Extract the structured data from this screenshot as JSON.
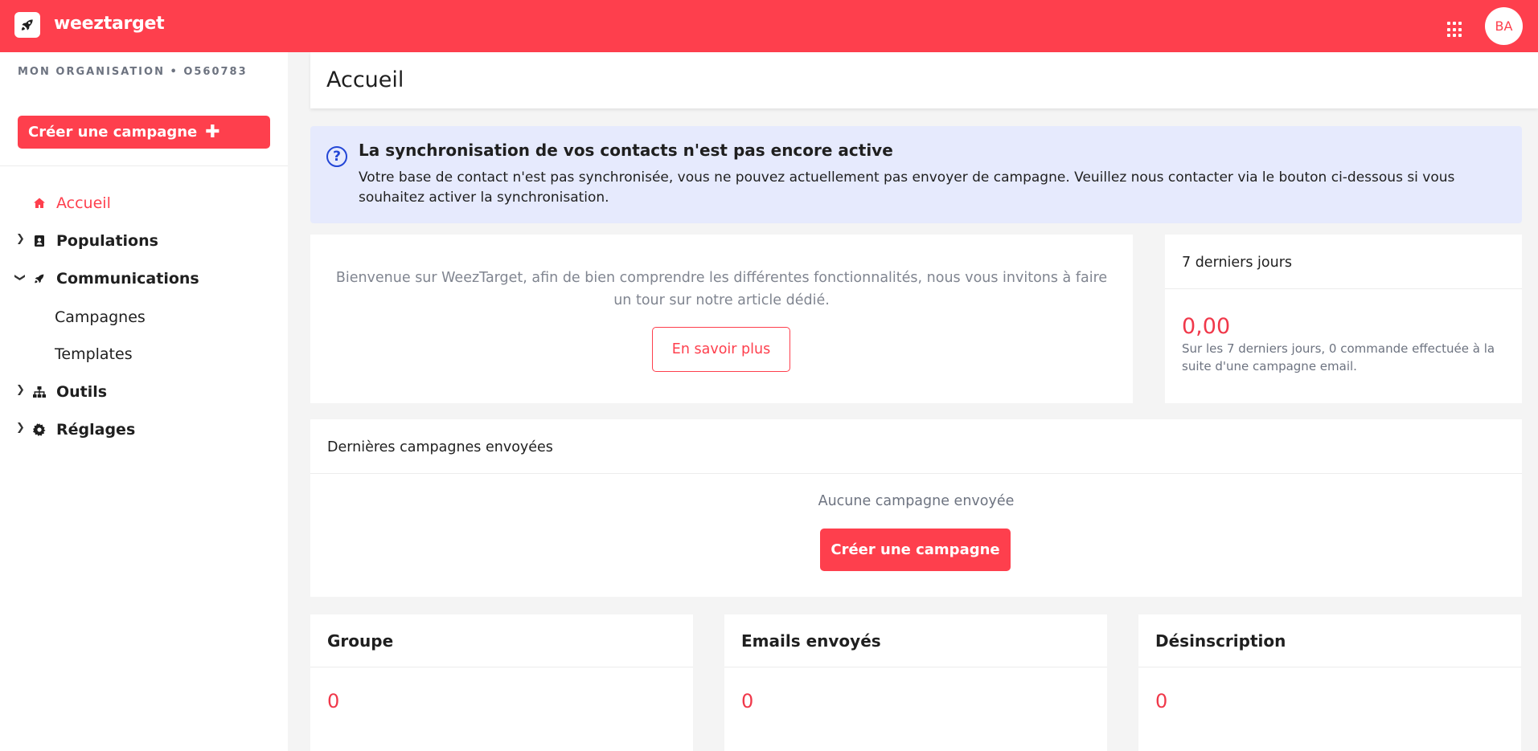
{
  "app": {
    "brand": "weeztarget",
    "avatar_initials": "BA",
    "accent_color": "#fe3f4d"
  },
  "sidebar": {
    "organization": "MON ORGANISATION • O560783",
    "create_button": "Créer une campagne",
    "create_button_icon": "plus-icon",
    "items": [
      {
        "label": "Accueil",
        "icon": "home-icon",
        "active": true
      },
      {
        "label": "Populations",
        "icon": "contact-icon",
        "expanded": false
      },
      {
        "label": "Communications",
        "icon": "rocket-icon",
        "expanded": true,
        "children": [
          {
            "label": "Campagnes"
          },
          {
            "label": "Templates"
          }
        ]
      },
      {
        "label": "Outils",
        "icon": "sitemap-icon",
        "expanded": false
      },
      {
        "label": "Réglages",
        "icon": "gear-icon",
        "expanded": false
      }
    ]
  },
  "page": {
    "title": "Accueil"
  },
  "alert": {
    "title": "La synchronisation de vos contacts n'est pas encore active",
    "text": "Votre base de contact n'est pas synchronisée, vous ne pouvez actuellement pas envoyer de campagne. Veuillez nous contacter via le bouton ci-dessous si vous souhaitez activer la synchronisation.",
    "icon": "question-circle-icon"
  },
  "welcome": {
    "text": "Bienvenue sur WeezTarget, afin de bien comprendre les différentes fonctionnalités, nous vous invitons à faire un tour sur notre article dédié.",
    "button": "En savoir plus"
  },
  "last_days": {
    "title": "7 derniers jours",
    "value": "0,00",
    "description": "Sur les 7 derniers jours, 0 commande effectuée à la suite d'une campagne email."
  },
  "recent_campaigns": {
    "title": "Dernières campagnes envoyées",
    "empty_text": "Aucune campagne envoyée",
    "button": "Créer une campagne"
  },
  "stats": [
    {
      "title": "Groupe",
      "value": "0"
    },
    {
      "title": "Emails envoyés",
      "value": "0"
    },
    {
      "title": "Désinscription",
      "value": "0"
    }
  ]
}
